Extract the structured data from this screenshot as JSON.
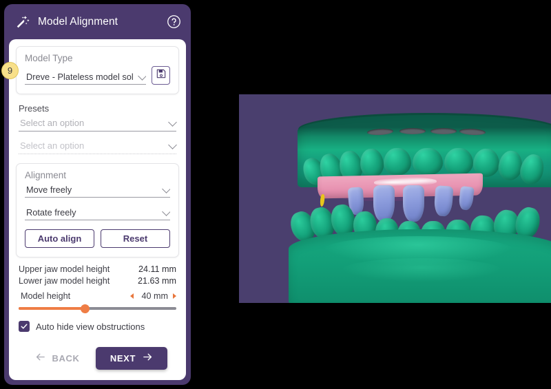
{
  "app": {
    "header": {
      "title": "Model Alignment",
      "wand_icon": "magic-wand-icon",
      "help_icon": "help-circle-icon"
    },
    "badge": {
      "number": "9"
    }
  },
  "model_type": {
    "label": "Model Type",
    "selected": "Dreve - Plateless model solid (",
    "save_icon": "floppy-disk-save-icon"
  },
  "presets": {
    "label": "Presets",
    "first": {
      "placeholder": "Select an option",
      "value": "Select an option"
    },
    "second": {
      "placeholder": "Select an option",
      "value": "Select an option"
    }
  },
  "alignment": {
    "label": "Alignment",
    "move_mode": "Move freely",
    "rotate_mode": "Rotate freely",
    "auto_align_label": "Auto align",
    "reset_label": "Reset"
  },
  "measurements": {
    "rows": [
      {
        "label": "Upper jaw model height",
        "value": "24.11 mm"
      },
      {
        "label": "Lower jaw model height",
        "value": "21.63 mm"
      }
    ]
  },
  "model_height": {
    "label": "Model height",
    "value": "40 mm",
    "fill_percent": 42
  },
  "options": {
    "auto_hide_label": "Auto hide view obstructions",
    "auto_hide_checked": true
  },
  "footer": {
    "back_label": "BACK",
    "next_label": "NEXT"
  },
  "viewport": {
    "background_color": "#4a3f6e",
    "model_color": "#16a77f",
    "gingiva_color": "#e894b2",
    "prep_color": "#8e9ede",
    "marker_color": "#e8c51c"
  },
  "theme": {
    "accent": "#4b3a6e",
    "slider_accent": "#ef7d45",
    "badge": "#f8e08a"
  }
}
